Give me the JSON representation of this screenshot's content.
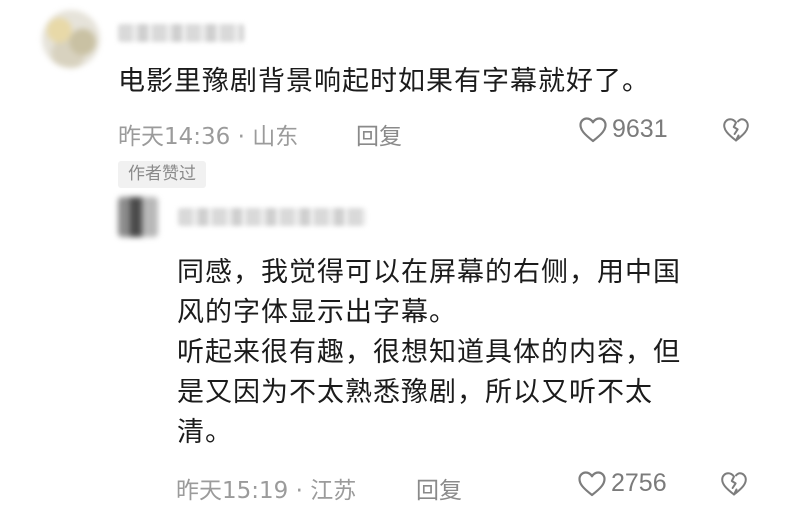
{
  "comment": {
    "text": "电影里豫剧背景响起时如果有字幕就好了。",
    "time_location": "昨天14:36 · 山东",
    "reply_label": "回复",
    "likes": "9631",
    "author_badge": "作者赞过"
  },
  "reply": {
    "lines": [
      "同感，我觉得可以在屏幕的右侧，用中国",
      "风的字体显示出字幕。",
      "听起来很有趣，很想知道具体的内容，但",
      "是又因为不太熟悉豫剧，所以又听不太",
      "清。"
    ],
    "time_location": "昨天15:19 · 江苏",
    "reply_label": "回复",
    "likes": "2756"
  },
  "icons": {
    "like": "heart-outline-icon",
    "dislike": "broken-heart-icon"
  }
}
